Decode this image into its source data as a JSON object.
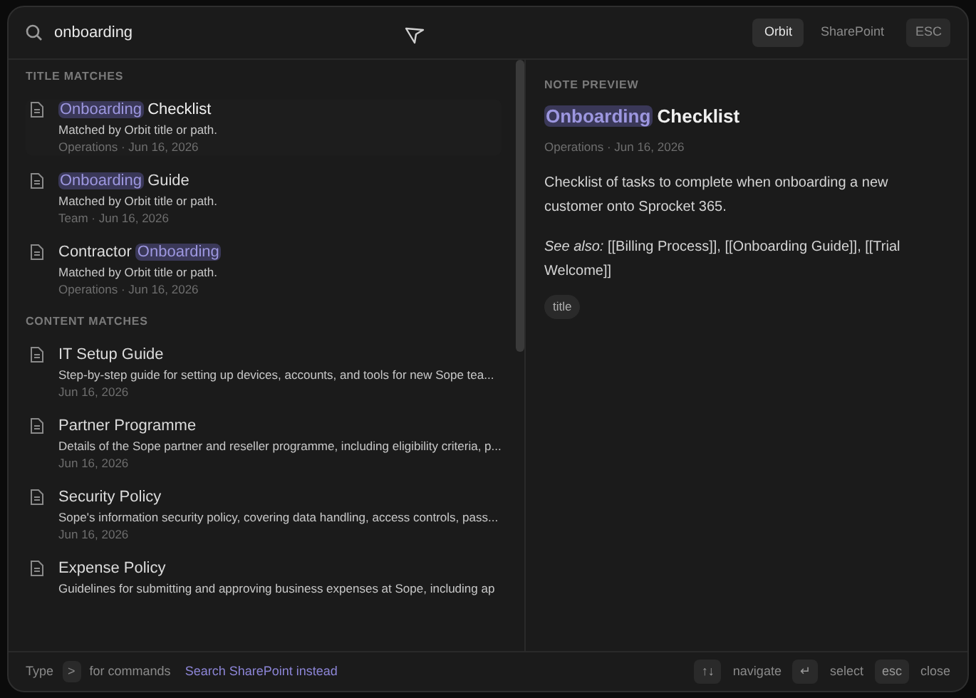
{
  "search": {
    "value": "onboarding"
  },
  "scopes": [
    {
      "label": "Orbit",
      "selected": true
    },
    {
      "label": "SharePoint",
      "selected": false
    }
  ],
  "close_key": "ESC",
  "sections": [
    {
      "heading": "TITLE MATCHES",
      "items": [
        {
          "title": [
            {
              "text": "Onboarding",
              "highlight": true
            },
            {
              "text": "Checklist",
              "highlight": false
            }
          ],
          "snippet": "Matched by Orbit title or path.",
          "meta": "Operations · Jun 16, 2026",
          "selected": true
        },
        {
          "title": [
            {
              "text": "Onboarding",
              "highlight": true
            },
            {
              "text": "Guide",
              "highlight": false
            }
          ],
          "snippet": "Matched by Orbit title or path.",
          "meta": "Team · Jun 16, 2026",
          "selected": false
        },
        {
          "title": [
            {
              "text": "Contractor",
              "highlight": false
            },
            {
              "text": "Onboarding",
              "highlight": true
            }
          ],
          "snippet": "Matched by Orbit title or path.",
          "meta": "Operations · Jun 16, 2026",
          "selected": false
        }
      ]
    },
    {
      "heading": "CONTENT MATCHES",
      "items": [
        {
          "title": [
            {
              "text": "IT Setup Guide",
              "highlight": false
            }
          ],
          "snippet": "Step-by-step guide for setting up devices, accounts, and tools for new Sope tea...",
          "meta": "Jun 16, 2026",
          "selected": false
        },
        {
          "title": [
            {
              "text": "Partner Programme",
              "highlight": false
            }
          ],
          "snippet": "Details of the Sope partner and reseller programme, including eligibility criteria, p...",
          "meta": "Jun 16, 2026",
          "selected": false
        },
        {
          "title": [
            {
              "text": "Security Policy",
              "highlight": false
            }
          ],
          "snippet": "Sope's information security policy, covering data handling, access controls, pass...",
          "meta": "Jun 16, 2026",
          "selected": false
        },
        {
          "title": [
            {
              "text": "Expense Policy",
              "highlight": false
            }
          ],
          "snippet": "Guidelines for submitting and approving business expenses at Sope, including ap",
          "selected": false
        }
      ]
    }
  ],
  "preview": {
    "heading": "NOTE PREVIEW",
    "title": [
      {
        "text": "Onboarding",
        "highlight": true
      },
      {
        "text": "Checklist",
        "highlight": false
      }
    ],
    "meta": "Operations · Jun 16, 2026",
    "paragraphs": [
      "Checklist of tasks to complete when onboarding a new customer onto Sprocket 365.",
      "*See also:* [[Billing Process]], [[Onboarding Guide]], [[Trial Welcome]]"
    ],
    "tags": [
      "title"
    ]
  },
  "footer": {
    "hint_before": "Type",
    "hint_key": ">",
    "hint_after": "for commands",
    "link": "Search SharePoint instead",
    "shortcuts": [
      {
        "key": "↑↓",
        "label": "navigate"
      },
      {
        "key": "↵",
        "label": "select"
      },
      {
        "key": "esc",
        "label": "close"
      }
    ]
  }
}
